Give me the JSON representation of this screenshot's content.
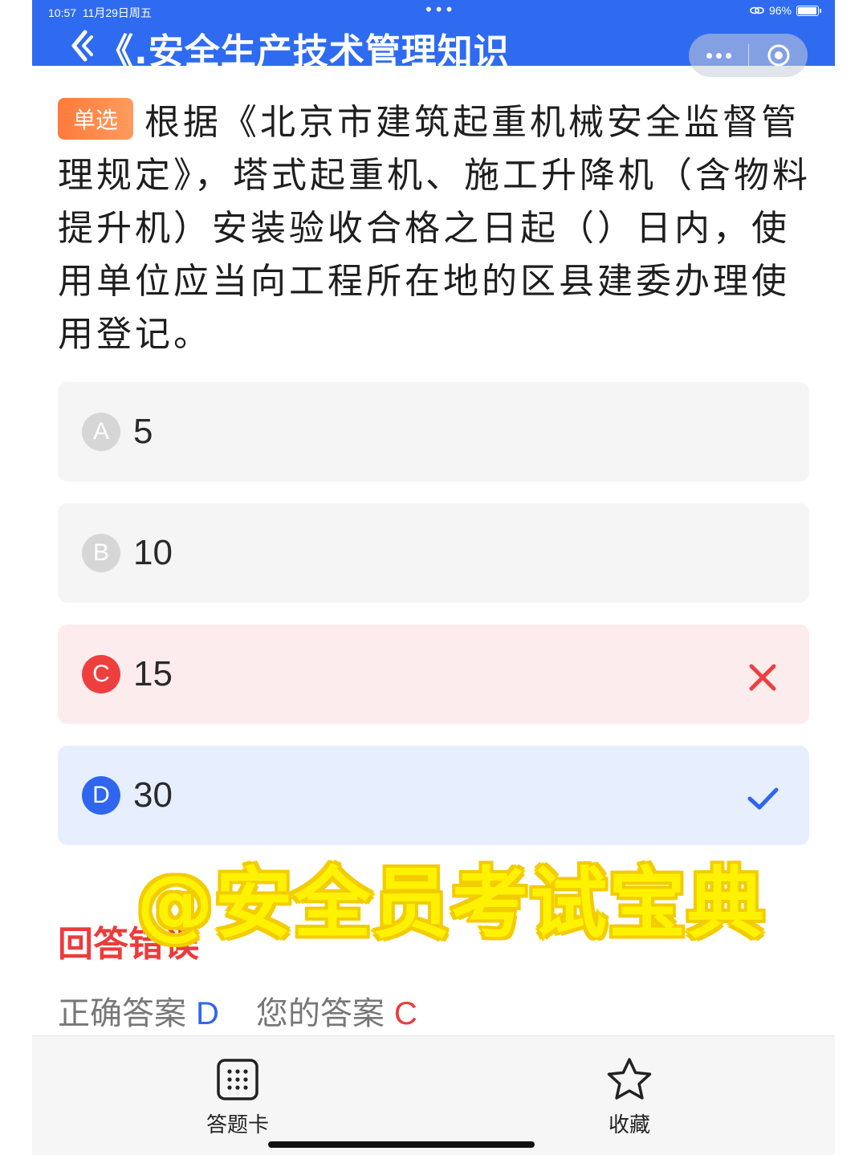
{
  "status": {
    "time": "10:57",
    "date": "11月29日周五",
    "battery": "96%"
  },
  "header": {
    "title": "《.安全生产技术管理知识",
    "back_icon": "back-chevron-icon",
    "more_icon": "more-dots-icon",
    "close_icon": "target-circle-icon",
    "color": "#2f6bf0"
  },
  "question": {
    "type_tag": "单选",
    "text": "根据《北京市建筑起重机械安全监督管理规定》，塔式起重机、施工升降机（含物料提升机）安装验收合格之日起（）日内，使用单位应当向工程所在地的区县建委办理使用登记。"
  },
  "options": [
    {
      "letter": "A",
      "text": "5",
      "state": "normal"
    },
    {
      "letter": "B",
      "text": "10",
      "state": "normal"
    },
    {
      "letter": "C",
      "text": "15",
      "state": "wrong"
    },
    {
      "letter": "D",
      "text": "30",
      "state": "correct"
    }
  ],
  "result": {
    "title": "回答错误",
    "correct_label": "正确答案",
    "correct_value": "D",
    "your_label": "您的答案",
    "your_value": "C"
  },
  "watermark": "@安全员考试宝典",
  "bottom_nav": {
    "card_label": "答题卡",
    "card_icon": "grid-card-icon",
    "fav_label": "收藏",
    "fav_icon": "star-icon"
  },
  "colors": {
    "accent": "#2f66ee",
    "error": "#ec3b3b",
    "tag": "#ff7a3c"
  }
}
